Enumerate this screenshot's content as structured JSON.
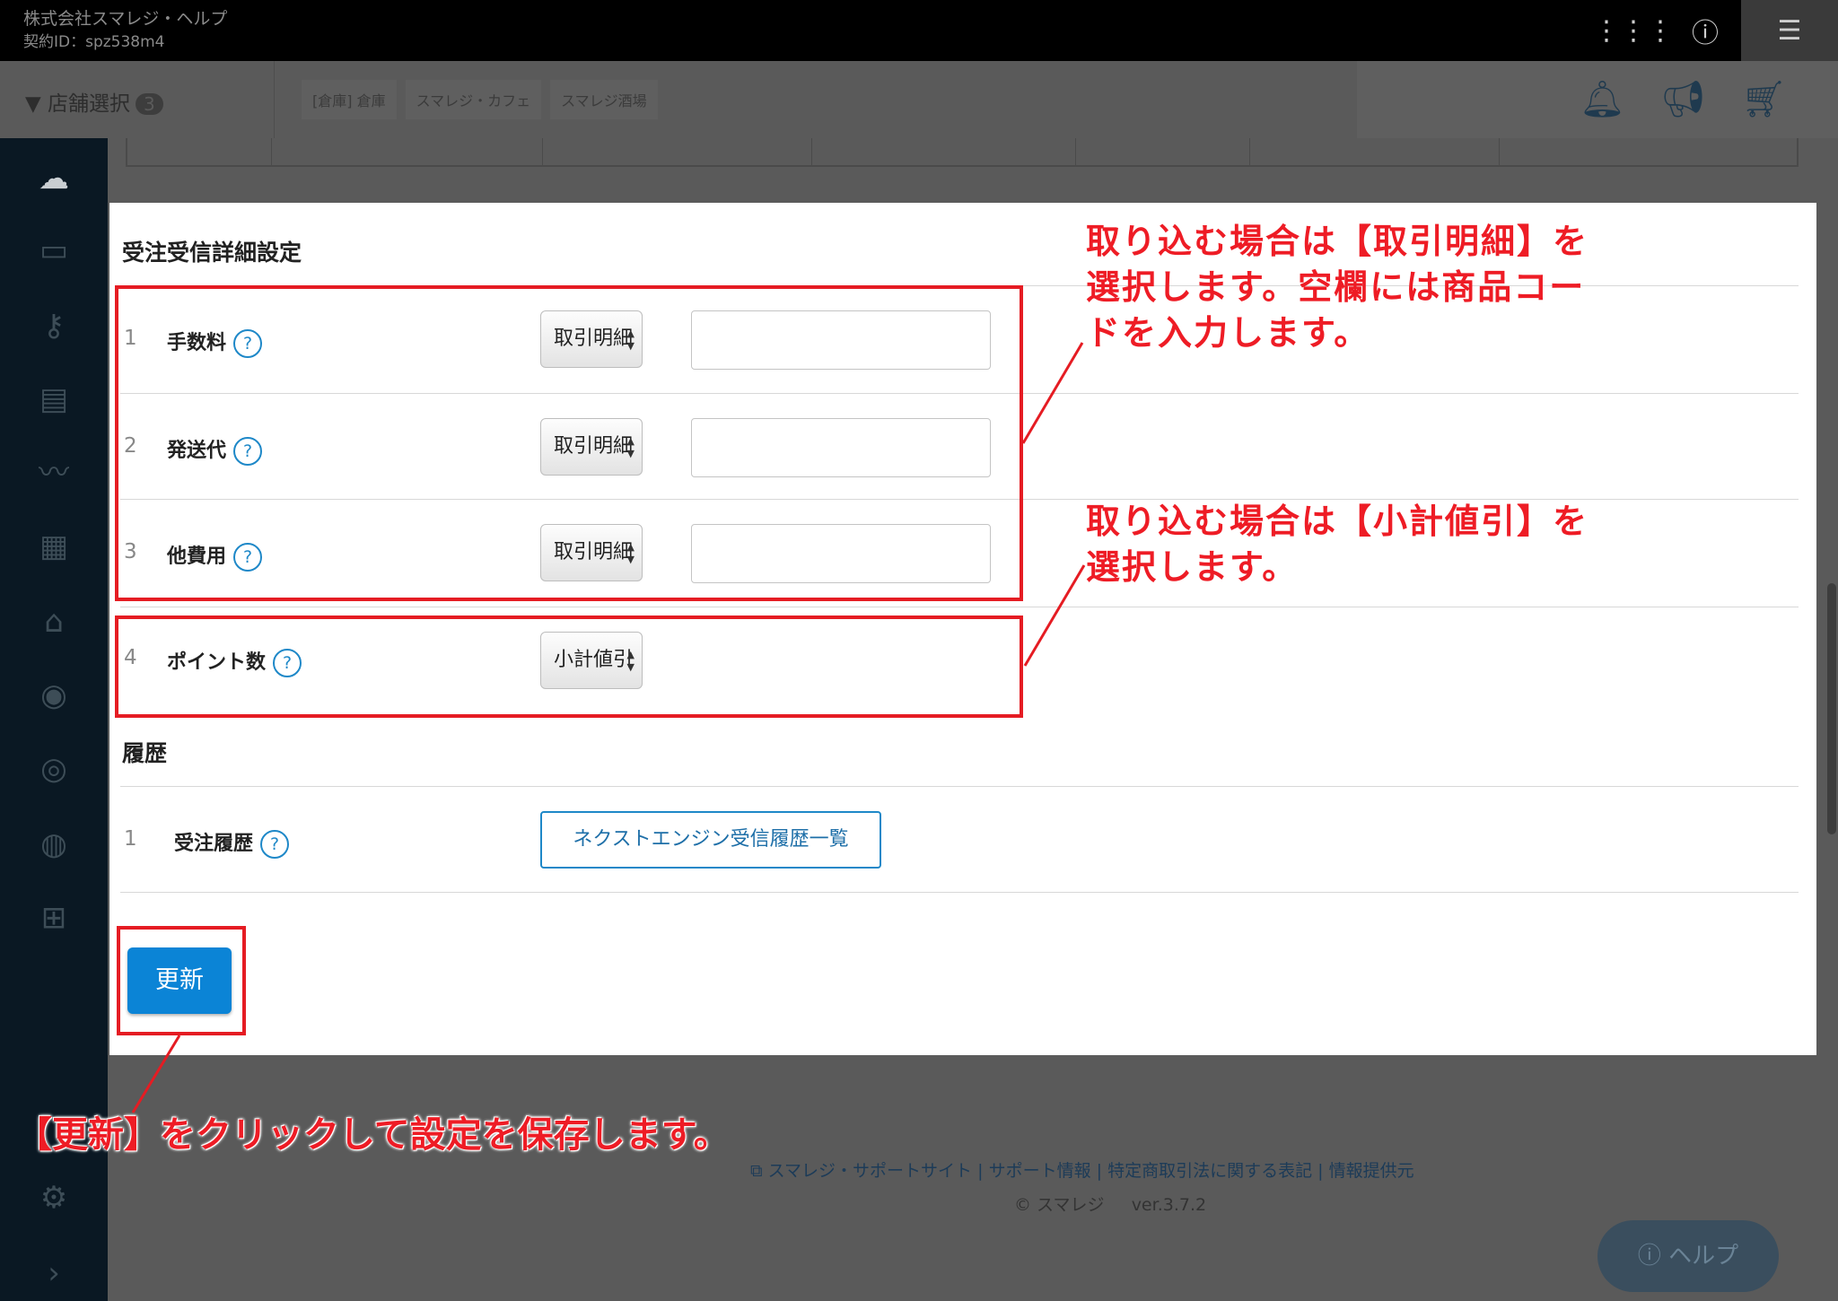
{
  "header": {
    "company": "株式会社スマレジ・ヘルプ",
    "contract": "契約ID：spz538m4",
    "icons": [
      "apps-grid-icon",
      "info-icon",
      "hamburger-menu-icon"
    ]
  },
  "store_bar": {
    "select_label": "店舗選択",
    "select_count": "3",
    "stores": [
      "[倉庫] 倉庫",
      "スマレジ・カフェ",
      "スマレジ酒場"
    ]
  },
  "sidebar": {
    "icons": [
      "cloud-icon",
      "archive-icon",
      "key-icon",
      "book-icon",
      "chart-icon",
      "report-icon",
      "store-icon",
      "user-icon",
      "target-icon",
      "member-icon",
      "grid-icon",
      "gear-icon",
      "chevron-right-icon"
    ]
  },
  "settings": {
    "section_title": "受注受信詳細設定",
    "rows": [
      {
        "num": "1",
        "label": "手数料",
        "select": "取引明細",
        "input": ""
      },
      {
        "num": "2",
        "label": "発送代",
        "select": "取引明細",
        "input": ""
      },
      {
        "num": "3",
        "label": "他費用",
        "select": "取引明細",
        "input": ""
      },
      {
        "num": "4",
        "label": "ポイント数",
        "select": "小計値引"
      }
    ],
    "help_glyph": "?"
  },
  "history": {
    "section_title": "履歴",
    "row_num": "1",
    "row_label": "受注履歴",
    "button": "ネクストエンジン受信履歴一覧"
  },
  "update_button": "更新",
  "annotations": {
    "note1_lines": [
      "取り込む場合は【取引明細】を",
      "選択します。空欄には商品コー",
      "ドを入力します。"
    ],
    "note2_lines": [
      "取り込む場合は【小計値引】を",
      "選択します。"
    ],
    "note3": "【更新】をクリックして設定を保存します。",
    "color": "#ee1c25"
  },
  "footer": {
    "links": [
      "スマレジ・サポートサイト",
      "サポート情報",
      "特定商取引法に関する表記",
      "情報提供元"
    ],
    "separator": "|",
    "copyright": "© スマレジ",
    "version": "ver.3.7.2"
  },
  "help_button": "ヘルプ"
}
